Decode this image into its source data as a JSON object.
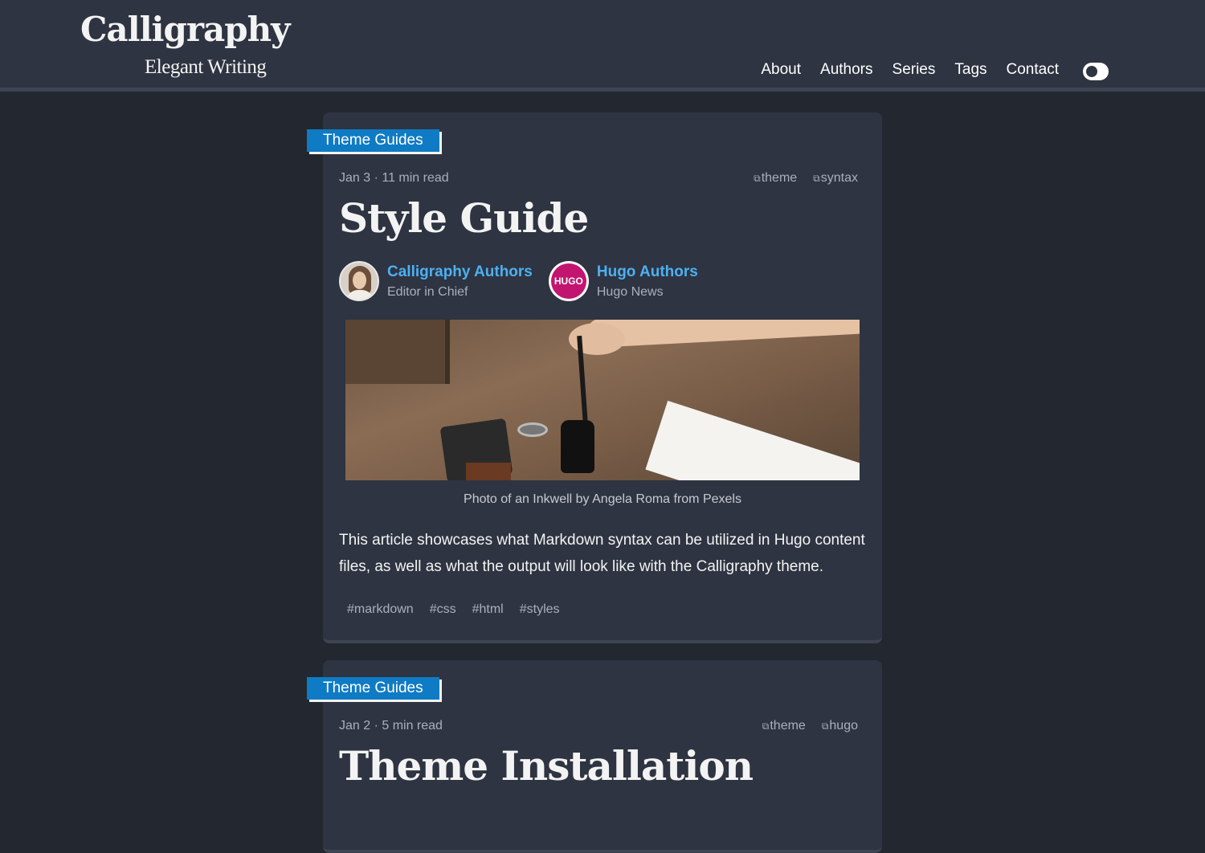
{
  "site": {
    "title": "Calligraphy",
    "subtitle": "Elegant Writing"
  },
  "nav": {
    "items": [
      "About",
      "Authors",
      "Series",
      "Tags",
      "Contact"
    ],
    "theme_toggle_icon": "toggle-icon"
  },
  "posts": [
    {
      "category": "Theme Guides",
      "date": "Jan 3 · 11 min read",
      "tags": [
        "theme",
        "syntax"
      ],
      "title": "Style Guide",
      "authors": [
        {
          "name": "Calligraphy Authors",
          "role": "Editor in Chief",
          "avatar": "photo-avatar"
        },
        {
          "name": "Hugo Authors",
          "role": "Hugo News",
          "avatar": "hugo-logo-avatar",
          "logo_text": "HUGO"
        }
      ],
      "image_caption": "Photo of an Inkwell by Angela Roma from Pexels",
      "summary": "This article showcases what Markdown syntax can be utilized in Hugo content files, as well as what the output will look like with the Calligraphy theme.",
      "hashtags": [
        "#markdown",
        "#css",
        "#html",
        "#styles"
      ]
    },
    {
      "category": "Theme Guides",
      "date": "Jan 2 · 5 min read",
      "tags": [
        "theme",
        "hugo"
      ],
      "title": "Theme Installation"
    }
  ],
  "colors": {
    "page_bg": "#23272f",
    "card_bg": "#2e3441",
    "category_bg": "#0f7bc4",
    "author_link": "#4db0f2"
  }
}
